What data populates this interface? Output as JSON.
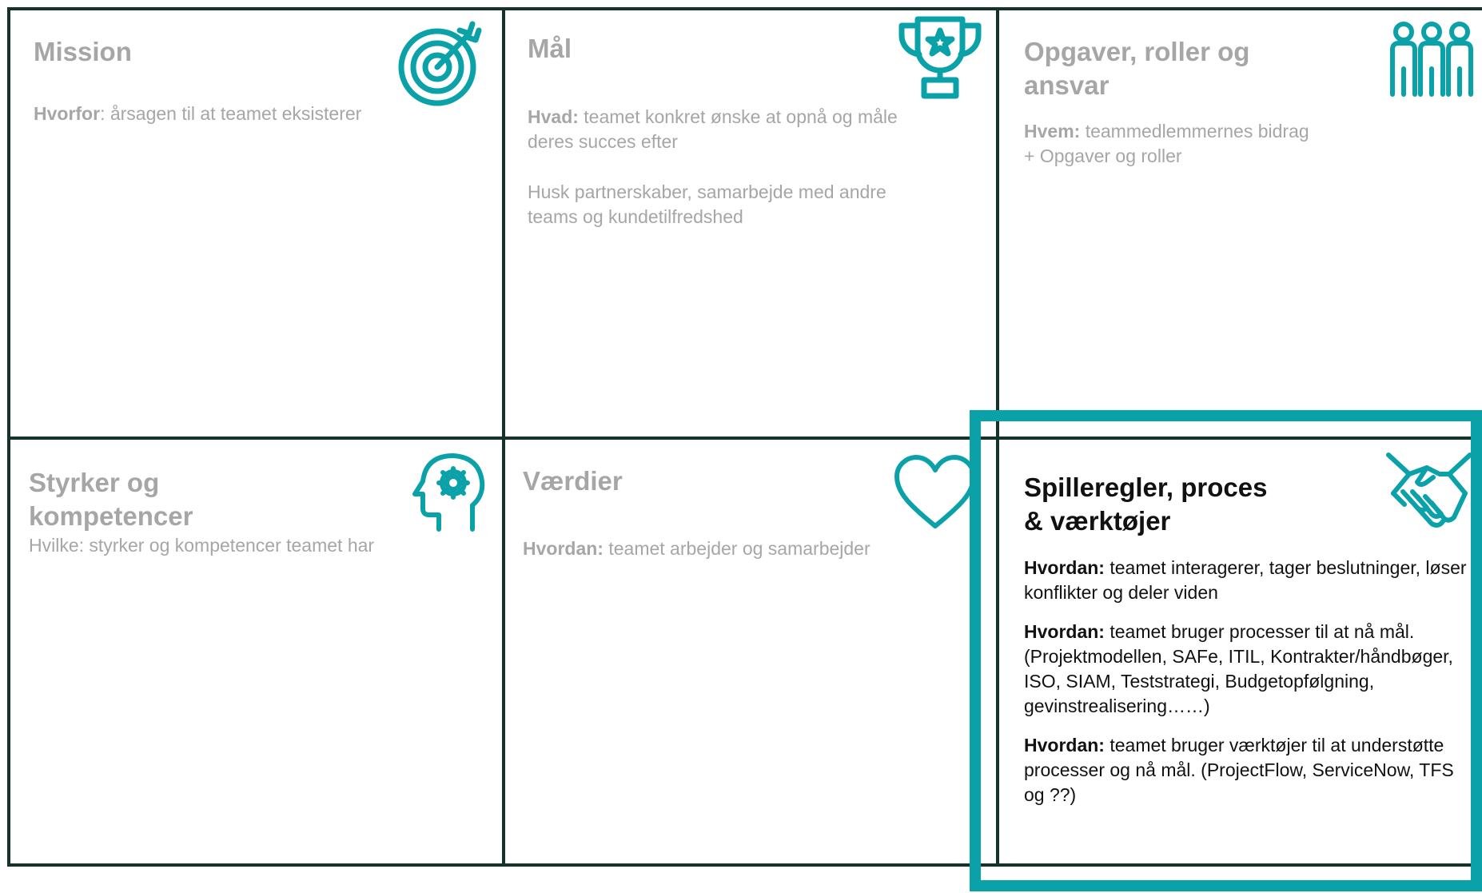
{
  "colors": {
    "border": "#14342b",
    "accent": "#0aa2a8",
    "muted_text": "#a6a6a6",
    "dark_text": "#111111"
  },
  "cells": {
    "mission": {
      "title": "Mission",
      "icon": "target-icon",
      "label": "Hvorfor",
      "text": ": årsagen til at teamet eksisterer"
    },
    "maal": {
      "title": "Mål",
      "icon": "trophy-icon",
      "label": "Hvad:",
      "text": " teamet konkret ønske at opnå og måle deres succes efter",
      "text2": "Husk partnerskaber, samarbejde med andre teams og kundetilfredshed"
    },
    "opgaver": {
      "title": "Opgaver, roller og ansvar",
      "icon": "team-icon",
      "label": "Hvem:",
      "text": " teammedlemmernes bidrag",
      "text2": "+ Opgaver og roller"
    },
    "styrker": {
      "title": "Styrker og kompetencer",
      "icon": "head-gear-icon",
      "text": "Hvilke: styrker og kompetencer teamet har"
    },
    "vaerdier": {
      "title": "Værdier",
      "icon": "heart-icon",
      "label": "Hvordan:",
      "text": " teamet arbejder og samarbejder"
    },
    "spilleregler": {
      "title_line1": "Spilleregler, proces",
      "title_line2": "& værktøjer",
      "icon": "handshake-icon",
      "p1_label": "Hvordan:",
      "p1_text": " teamet interagerer, tager beslutninger, løser konflikter og deler viden",
      "p2_label": "Hvordan:",
      "p2_text": " teamet bruger processer til at nå mål. (Projektmodellen, SAFe, ITIL, Kontrakter/håndbøger, ISO, SIAM, Teststrategi, Budgetopfølgning, gevinstrealisering……)",
      "p3_label": "Hvordan:",
      "p3_text": " teamet bruger værktøjer til at understøtte processer og nå mål. (ProjectFlow, ServiceNow, TFS og ??)"
    }
  }
}
